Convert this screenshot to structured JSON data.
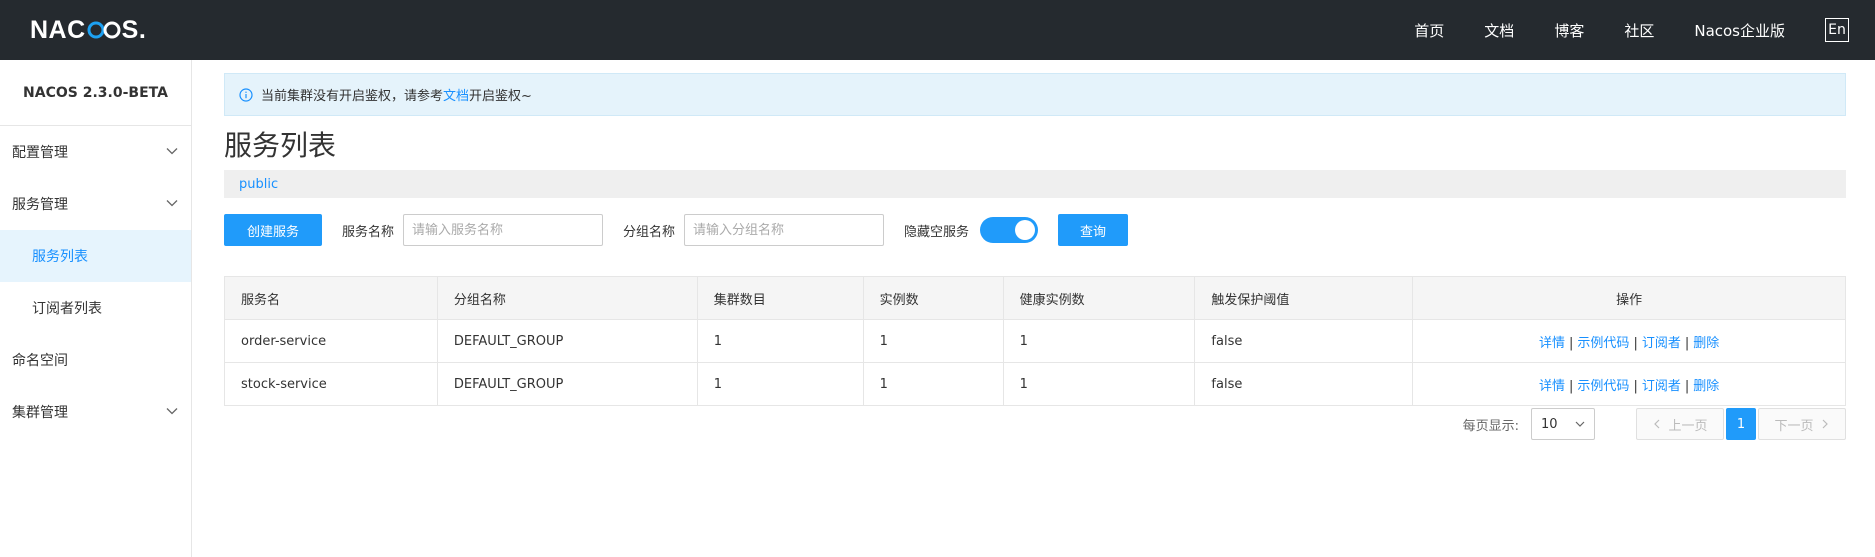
{
  "topbar": {
    "logo_prefix": "NAC",
    "logo_suffix": "S",
    "nav": [
      "首页",
      "文档",
      "博客",
      "社区",
      "Nacos企业版"
    ],
    "lang": "En"
  },
  "sidebar": {
    "version": "NACOS 2.3.0-BETA",
    "items": [
      {
        "label": "配置管理"
      },
      {
        "label": "服务管理"
      },
      {
        "label": "服务列表"
      },
      {
        "label": "订阅者列表"
      },
      {
        "label": "命名空间"
      },
      {
        "label": "集群管理"
      }
    ]
  },
  "notice": {
    "text_before": "当前集群没有开启鉴权，请参考",
    "link": "文档",
    "text_after": "开启鉴权~"
  },
  "page": {
    "title": "服务列表",
    "namespace": "public"
  },
  "filters": {
    "create_label": "创建服务",
    "service_name_label": "服务名称",
    "service_name_placeholder": "请输入服务名称",
    "group_name_label": "分组名称",
    "group_name_placeholder": "请输入分组名称",
    "hide_empty_label": "隐藏空服务",
    "hide_empty_on": true,
    "query_label": "查询"
  },
  "table": {
    "headers": [
      "服务名",
      "分组名称",
      "集群数目",
      "实例数",
      "健康实例数",
      "触发保护阈值",
      "操作"
    ],
    "rows": [
      [
        "order-service",
        "DEFAULT_GROUP",
        "1",
        "1",
        "1",
        "false"
      ],
      [
        "stock-service",
        "DEFAULT_GROUP",
        "1",
        "1",
        "1",
        "false"
      ]
    ],
    "actions": [
      "详情",
      "示例代码",
      "订阅者",
      "删除"
    ]
  },
  "pagination": {
    "per_page_label": "每页显示:",
    "per_page_value": "10",
    "prev_label": "上一页",
    "current_page": "1",
    "next_label": "下一页"
  },
  "colors": {
    "accent": "#209bfa",
    "topbar": "#252a2f",
    "link": "#1890ff"
  }
}
